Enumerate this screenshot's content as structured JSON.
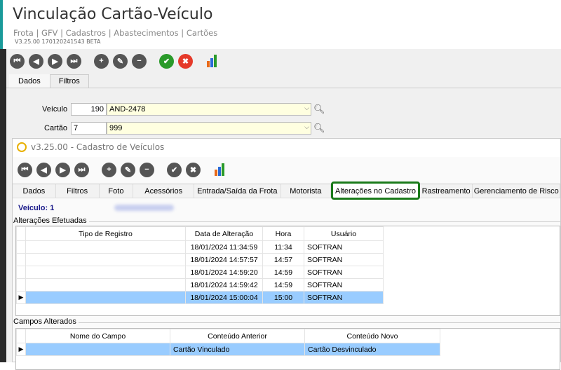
{
  "window": {
    "title": "Vinculação Cartão-Veículo",
    "breadcrumb": "Frota | GFV | Cadastros | Abastecimentos | Cartões",
    "version": "V3.25.00 170120241543 BETA"
  },
  "toolbar": {
    "first": "⏮",
    "prev": "◀",
    "next": "▶",
    "last": "⏭",
    "add": "+",
    "edit": "✎",
    "remove": "−",
    "confirm": "✔",
    "cancel": "✖"
  },
  "tabs": [
    {
      "label": "Dados"
    },
    {
      "label": "Filtros"
    }
  ],
  "form": {
    "vehicle_label": "Veículo",
    "vehicle_code": "190",
    "vehicle_plate": "AND-2478",
    "card_label": "Cartão",
    "card_code": "7",
    "card_number": "999"
  },
  "child": {
    "title": "v3.25.00 - Cadastro de Veículos",
    "tabs": [
      {
        "label": "Dados"
      },
      {
        "label": "Filtros"
      },
      {
        "label": "Foto"
      },
      {
        "label": "Acessórios"
      },
      {
        "label": "Entrada/Saída da Frota"
      },
      {
        "label": "Motorista"
      },
      {
        "label": "Alterações no Cadastro"
      },
      {
        "label": "Rastreamento"
      },
      {
        "label": "Gerenciamento de Risco"
      }
    ],
    "vehicle_heading": "Veículo: 1",
    "changes_group": "Alterações Efetuadas",
    "changes_columns": [
      "Tipo de Registro",
      "Data de Alteração",
      "Hora",
      "Usuário"
    ],
    "changes_rows": [
      {
        "tipo": "",
        "data": "18/01/2024 11:34:59",
        "hora": "11:34",
        "usuario": "SOFTRAN"
      },
      {
        "tipo": "",
        "data": "18/01/2024 14:57:57",
        "hora": "14:57",
        "usuario": "SOFTRAN"
      },
      {
        "tipo": "",
        "data": "18/01/2024 14:59:20",
        "hora": "14:59",
        "usuario": "SOFTRAN"
      },
      {
        "tipo": "",
        "data": "18/01/2024 14:59:42",
        "hora": "14:59",
        "usuario": "SOFTRAN"
      },
      {
        "tipo": "",
        "data": "18/01/2024 15:00:04",
        "hora": "15:00",
        "usuario": "SOFTRAN"
      }
    ],
    "fields_group": "Campos Alterados",
    "fields_columns": [
      "Nome do Campo",
      "Conteúdo Anterior",
      "Conteúdo Novo"
    ],
    "fields_rows": [
      {
        "campo": "",
        "anterior": "Cartão Vinculado",
        "novo": "Cartão Desvinculado"
      }
    ],
    "row_pointer": "▶"
  },
  "colors": {
    "accent": "#1a7a1a",
    "selection": "#99ccff",
    "heading": "#1a1a8a"
  }
}
